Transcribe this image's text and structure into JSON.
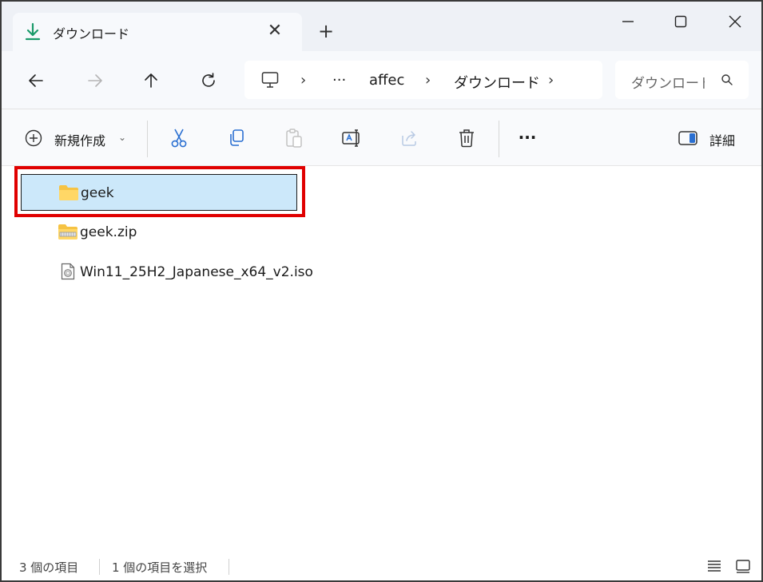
{
  "tab": {
    "title": "ダウンロード",
    "close": "✕",
    "new": "+"
  },
  "nav": {
    "breadcrumb": [
      "affec",
      "ダウンロード"
    ],
    "overflow": "···",
    "search_placeholder": "ダウンロード の検索"
  },
  "toolbar": {
    "new_label": "新規作成",
    "details_label": "詳細",
    "more": "···"
  },
  "files": [
    {
      "name": "geek",
      "type": "folder",
      "selected": true
    },
    {
      "name": "geek.zip",
      "type": "zip-folder",
      "selected": false
    },
    {
      "name": "Win11_25H2_Japanese_x64_v2.iso",
      "type": "disc-image",
      "selected": false
    }
  ],
  "status": {
    "count": "3 個の項目",
    "selection": "1 個の項目を選択"
  },
  "colors": {
    "accent": "#1a9a6a",
    "selection_bg": "#cce8fa",
    "highlight": "#e00000",
    "folder": "#f6c343"
  }
}
